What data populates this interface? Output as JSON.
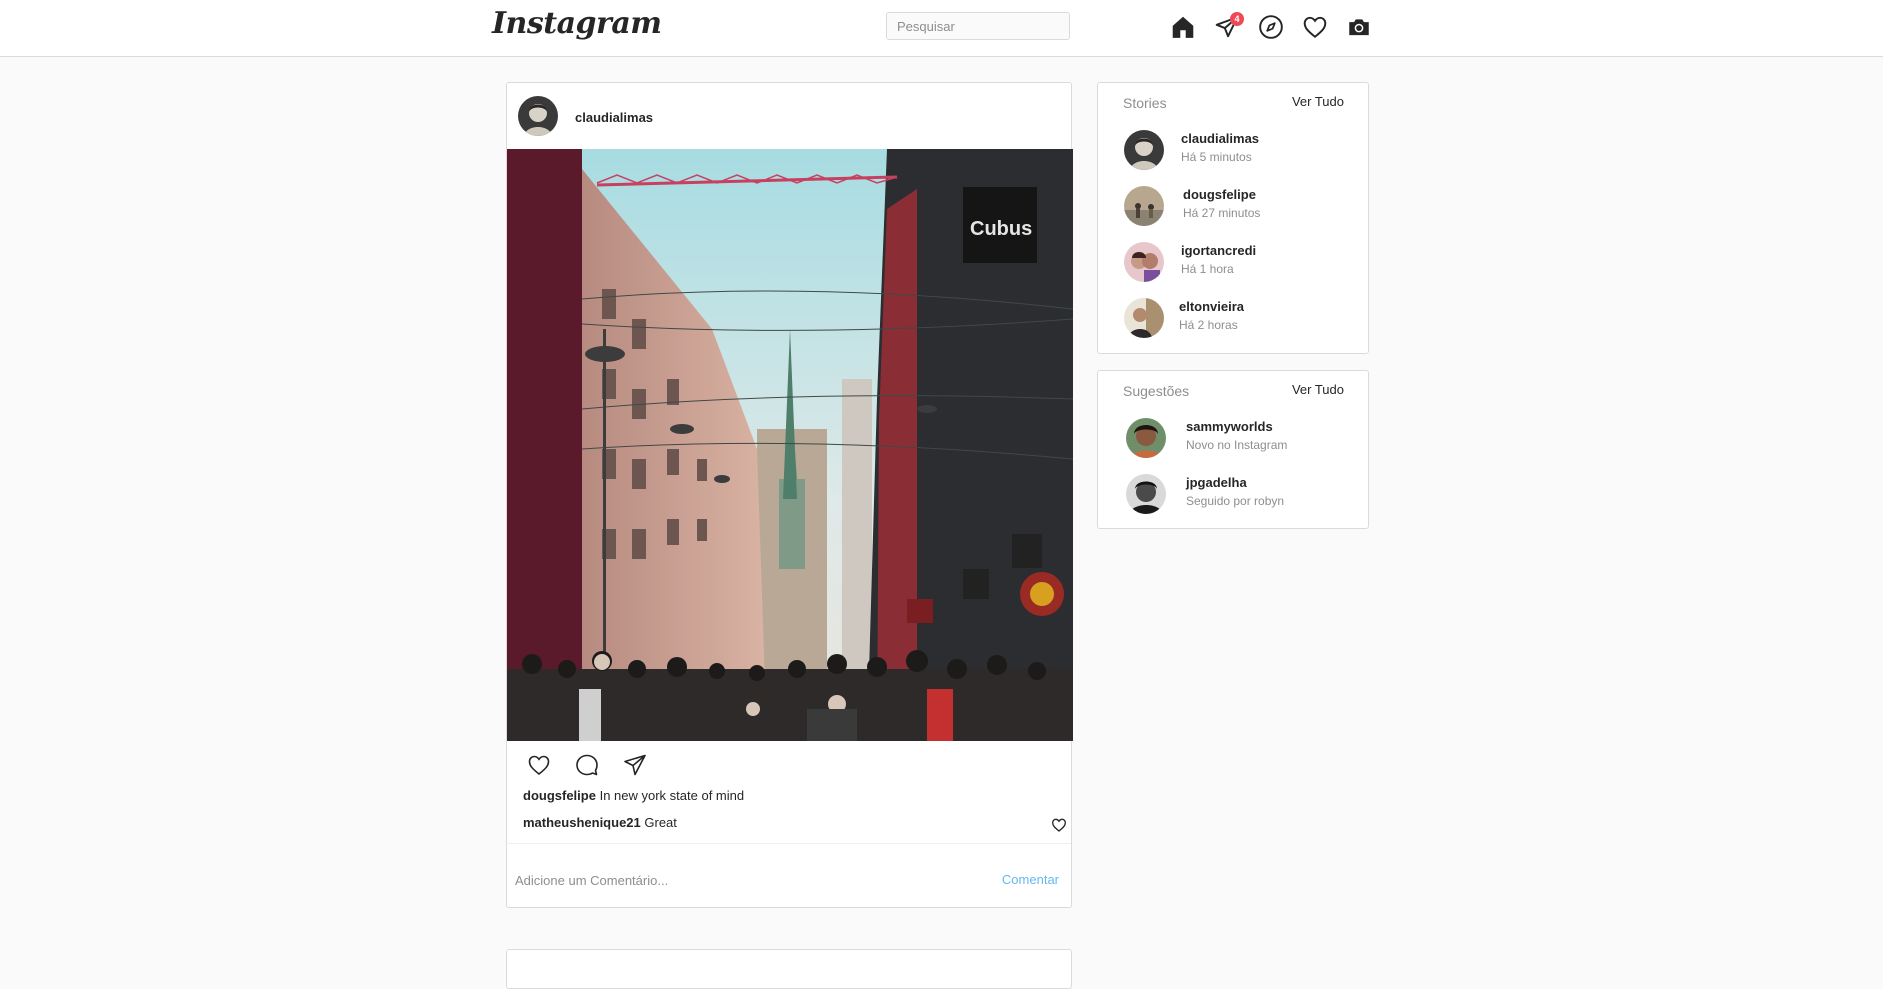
{
  "header": {
    "logo": "Instagram",
    "search_placeholder": "Pesquisar",
    "messages_badge": "4",
    "icons": [
      "home-icon",
      "direct-message-icon",
      "explore-icon",
      "activity-heart-icon",
      "camera-icon"
    ]
  },
  "post": {
    "username": "claudialimas",
    "caption_user": "dougsfelipe",
    "caption_text": "In new york state of mind",
    "comment_user": "matheushenique21",
    "comment_text": "Great",
    "comment_placeholder": "Adicione um Comentário...",
    "comment_button": "Comentar"
  },
  "stories": {
    "title": "Stories",
    "link": "Ver Tudo",
    "items": [
      {
        "name": "claudialimas",
        "time": "Há 5 minutos"
      },
      {
        "name": "dougsfelipe",
        "time": "Há 27 minutos"
      },
      {
        "name": "igortancredi",
        "time": "Há 1 hora"
      },
      {
        "name": "eltonvieira",
        "time": "Há 2 horas"
      }
    ]
  },
  "suggestions": {
    "title": "Sugestões",
    "link": "Ver Tudo",
    "items": [
      {
        "name": "sammyworlds",
        "note": "Novo no Instagram"
      },
      {
        "name": "jpgadelha",
        "note": "Seguido por robyn"
      }
    ]
  },
  "colors": {
    "accent_link": "#66b8f0",
    "badge": "#ed4956",
    "border": "#dbdbdb",
    "background": "#fafafa"
  }
}
